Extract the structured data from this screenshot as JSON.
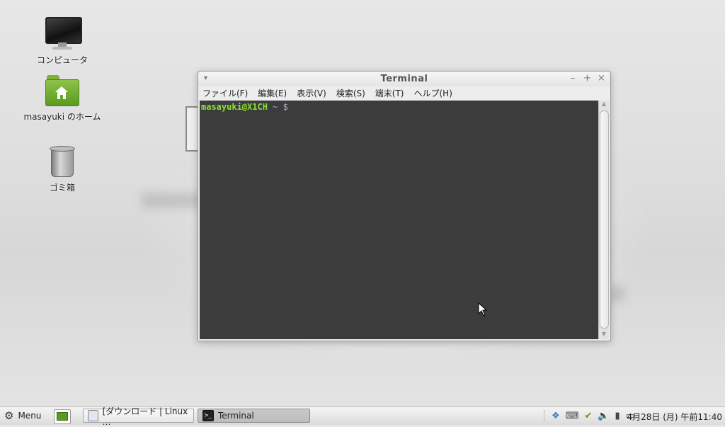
{
  "desktop": {
    "icons": [
      {
        "label": "コンピュータ",
        "icon": "computer-icon"
      },
      {
        "label": "masayuki のホーム",
        "icon": "home-folder-icon"
      },
      {
        "label": "ゴミ箱",
        "icon": "trash-icon"
      }
    ]
  },
  "window": {
    "title": "Terminal",
    "menu_icon": "▾",
    "controls": {
      "minimize": "–",
      "maximize": "+",
      "close": "×"
    },
    "menus": [
      "ファイル(F)",
      "編集(E)",
      "表示(V)",
      "検索(S)",
      "端末(T)",
      "ヘルプ(H)"
    ],
    "prompt": {
      "user": "masayuki@X1CH",
      "path": " ~ ",
      "symbol": "$"
    }
  },
  "taskbar": {
    "menu_label": "Menu",
    "tasks": [
      {
        "label": "[ダウンロード | Linux …",
        "active": false
      },
      {
        "label": "Terminal",
        "active": true
      }
    ],
    "tray_icons": [
      "dropbox-icon",
      "keyboard-icon",
      "update-shield-icon",
      "volume-icon",
      "network-signal-icon",
      "battery-icon"
    ],
    "clock": "4月28日 (月) 午前11:40"
  },
  "colors": {
    "terminal_bg": "#3c3c3c",
    "prompt_user": "#8ae234",
    "prompt_path": "#9fb3c8"
  }
}
